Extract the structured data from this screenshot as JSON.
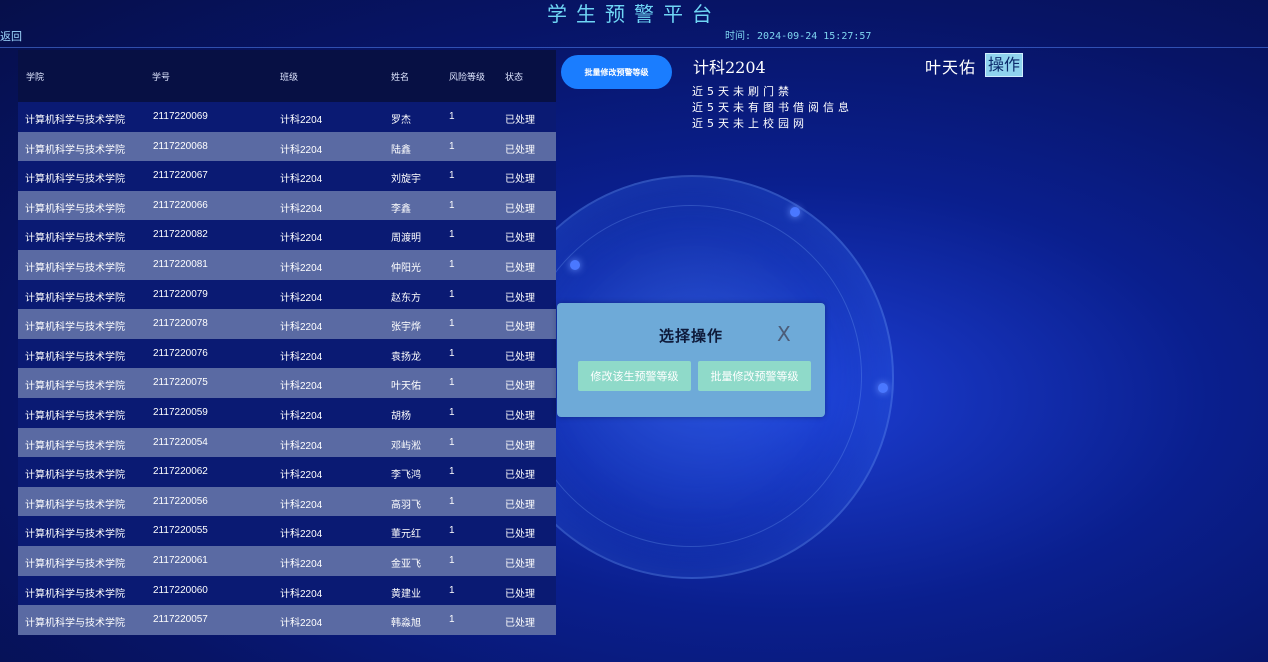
{
  "header": {
    "title": "学生预警平台",
    "time": "时间: 2024-09-24 15:27:57",
    "back_label": "返回"
  },
  "table": {
    "columns": [
      "学院",
      "学号",
      "班级",
      "姓名",
      "风险等级",
      "状态"
    ],
    "rows": [
      [
        "计算机科学与技术学院",
        "2117220069",
        "计科2204",
        "罗杰",
        "1",
        "已处理"
      ],
      [
        "计算机科学与技术学院",
        "2117220068",
        "计科2204",
        "陆鑫",
        "1",
        "已处理"
      ],
      [
        "计算机科学与技术学院",
        "2117220067",
        "计科2204",
        "刘旋宇",
        "1",
        "已处理"
      ],
      [
        "计算机科学与技术学院",
        "2117220066",
        "计科2204",
        "李鑫",
        "1",
        "已处理"
      ],
      [
        "计算机科学与技术学院",
        "2117220082",
        "计科2204",
        "周渡明",
        "1",
        "已处理"
      ],
      [
        "计算机科学与技术学院",
        "2117220081",
        "计科2204",
        "仲阳光",
        "1",
        "已处理"
      ],
      [
        "计算机科学与技术学院",
        "2117220079",
        "计科2204",
        "赵东方",
        "1",
        "已处理"
      ],
      [
        "计算机科学与技术学院",
        "2117220078",
        "计科2204",
        "张宇烨",
        "1",
        "已处理"
      ],
      [
        "计算机科学与技术学院",
        "2117220076",
        "计科2204",
        "袁扬龙",
        "1",
        "已处理"
      ],
      [
        "计算机科学与技术学院",
        "2117220075",
        "计科2204",
        "叶天佑",
        "1",
        "已处理"
      ],
      [
        "计算机科学与技术学院",
        "2117220059",
        "计科2204",
        "胡杨",
        "1",
        "已处理"
      ],
      [
        "计算机科学与技术学院",
        "2117220054",
        "计科2204",
        "邓屿淞",
        "1",
        "已处理"
      ],
      [
        "计算机科学与技术学院",
        "2117220062",
        "计科2204",
        "李飞鸿",
        "1",
        "已处理"
      ],
      [
        "计算机科学与技术学院",
        "2117220056",
        "计科2204",
        "高羽飞",
        "1",
        "已处理"
      ],
      [
        "计算机科学与技术学院",
        "2117220055",
        "计科2204",
        "董元红",
        "1",
        "已处理"
      ],
      [
        "计算机科学与技术学院",
        "2117220061",
        "计科2204",
        "金亚飞",
        "1",
        "已处理"
      ],
      [
        "计算机科学与技术学院",
        "2117220060",
        "计科2204",
        "黄建业",
        "1",
        "已处理"
      ],
      [
        "计算机科学与技术学院",
        "2117220057",
        "计科2204",
        "韩淼旭",
        "1",
        "已处理"
      ]
    ]
  },
  "batch_button_label": "批量修改预警等级",
  "info": {
    "class_name": "计科2204",
    "student_name": "叶天佑",
    "operate_label": "操作",
    "alerts": [
      "近5天未刷门禁",
      "近5天未有图书借阅信息",
      "近5天未上校园网"
    ]
  },
  "modal": {
    "title": "选择操作",
    "close_label": "X",
    "btn_single": "修改该生预警等级",
    "btn_batch": "批量修改预警等级"
  },
  "icons": {
    "close": "close-icon"
  },
  "colors": {
    "background": "#0a1f8e",
    "row_dark": "#0a1a73",
    "row_light": "#5a6aa3",
    "accent_button": "#1a7dff",
    "modal_bg": "#6eaad8",
    "modal_button": "#8fdac9",
    "title_color": "#6fd6f5"
  }
}
